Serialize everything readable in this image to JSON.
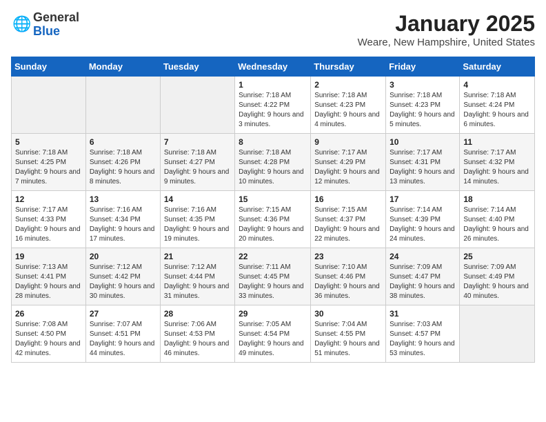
{
  "logo": {
    "general": "General",
    "blue": "Blue"
  },
  "header": {
    "month": "January 2025",
    "location": "Weare, New Hampshire, United States"
  },
  "days_of_week": [
    "Sunday",
    "Monday",
    "Tuesday",
    "Wednesday",
    "Thursday",
    "Friday",
    "Saturday"
  ],
  "weeks": [
    [
      {
        "day": "",
        "info": ""
      },
      {
        "day": "",
        "info": ""
      },
      {
        "day": "",
        "info": ""
      },
      {
        "day": "1",
        "info": "Sunrise: 7:18 AM\nSunset: 4:22 PM\nDaylight: 9 hours and 3 minutes."
      },
      {
        "day": "2",
        "info": "Sunrise: 7:18 AM\nSunset: 4:23 PM\nDaylight: 9 hours and 4 minutes."
      },
      {
        "day": "3",
        "info": "Sunrise: 7:18 AM\nSunset: 4:23 PM\nDaylight: 9 hours and 5 minutes."
      },
      {
        "day": "4",
        "info": "Sunrise: 7:18 AM\nSunset: 4:24 PM\nDaylight: 9 hours and 6 minutes."
      }
    ],
    [
      {
        "day": "5",
        "info": "Sunrise: 7:18 AM\nSunset: 4:25 PM\nDaylight: 9 hours and 7 minutes."
      },
      {
        "day": "6",
        "info": "Sunrise: 7:18 AM\nSunset: 4:26 PM\nDaylight: 9 hours and 8 minutes."
      },
      {
        "day": "7",
        "info": "Sunrise: 7:18 AM\nSunset: 4:27 PM\nDaylight: 9 hours and 9 minutes."
      },
      {
        "day": "8",
        "info": "Sunrise: 7:18 AM\nSunset: 4:28 PM\nDaylight: 9 hours and 10 minutes."
      },
      {
        "day": "9",
        "info": "Sunrise: 7:17 AM\nSunset: 4:29 PM\nDaylight: 9 hours and 12 minutes."
      },
      {
        "day": "10",
        "info": "Sunrise: 7:17 AM\nSunset: 4:31 PM\nDaylight: 9 hours and 13 minutes."
      },
      {
        "day": "11",
        "info": "Sunrise: 7:17 AM\nSunset: 4:32 PM\nDaylight: 9 hours and 14 minutes."
      }
    ],
    [
      {
        "day": "12",
        "info": "Sunrise: 7:17 AM\nSunset: 4:33 PM\nDaylight: 9 hours and 16 minutes."
      },
      {
        "day": "13",
        "info": "Sunrise: 7:16 AM\nSunset: 4:34 PM\nDaylight: 9 hours and 17 minutes."
      },
      {
        "day": "14",
        "info": "Sunrise: 7:16 AM\nSunset: 4:35 PM\nDaylight: 9 hours and 19 minutes."
      },
      {
        "day": "15",
        "info": "Sunrise: 7:15 AM\nSunset: 4:36 PM\nDaylight: 9 hours and 20 minutes."
      },
      {
        "day": "16",
        "info": "Sunrise: 7:15 AM\nSunset: 4:37 PM\nDaylight: 9 hours and 22 minutes."
      },
      {
        "day": "17",
        "info": "Sunrise: 7:14 AM\nSunset: 4:39 PM\nDaylight: 9 hours and 24 minutes."
      },
      {
        "day": "18",
        "info": "Sunrise: 7:14 AM\nSunset: 4:40 PM\nDaylight: 9 hours and 26 minutes."
      }
    ],
    [
      {
        "day": "19",
        "info": "Sunrise: 7:13 AM\nSunset: 4:41 PM\nDaylight: 9 hours and 28 minutes."
      },
      {
        "day": "20",
        "info": "Sunrise: 7:12 AM\nSunset: 4:42 PM\nDaylight: 9 hours and 30 minutes."
      },
      {
        "day": "21",
        "info": "Sunrise: 7:12 AM\nSunset: 4:44 PM\nDaylight: 9 hours and 31 minutes."
      },
      {
        "day": "22",
        "info": "Sunrise: 7:11 AM\nSunset: 4:45 PM\nDaylight: 9 hours and 33 minutes."
      },
      {
        "day": "23",
        "info": "Sunrise: 7:10 AM\nSunset: 4:46 PM\nDaylight: 9 hours and 36 minutes."
      },
      {
        "day": "24",
        "info": "Sunrise: 7:09 AM\nSunset: 4:47 PM\nDaylight: 9 hours and 38 minutes."
      },
      {
        "day": "25",
        "info": "Sunrise: 7:09 AM\nSunset: 4:49 PM\nDaylight: 9 hours and 40 minutes."
      }
    ],
    [
      {
        "day": "26",
        "info": "Sunrise: 7:08 AM\nSunset: 4:50 PM\nDaylight: 9 hours and 42 minutes."
      },
      {
        "day": "27",
        "info": "Sunrise: 7:07 AM\nSunset: 4:51 PM\nDaylight: 9 hours and 44 minutes."
      },
      {
        "day": "28",
        "info": "Sunrise: 7:06 AM\nSunset: 4:53 PM\nDaylight: 9 hours and 46 minutes."
      },
      {
        "day": "29",
        "info": "Sunrise: 7:05 AM\nSunset: 4:54 PM\nDaylight: 9 hours and 49 minutes."
      },
      {
        "day": "30",
        "info": "Sunrise: 7:04 AM\nSunset: 4:55 PM\nDaylight: 9 hours and 51 minutes."
      },
      {
        "day": "31",
        "info": "Sunrise: 7:03 AM\nSunset: 4:57 PM\nDaylight: 9 hours and 53 minutes."
      },
      {
        "day": "",
        "info": ""
      }
    ]
  ]
}
